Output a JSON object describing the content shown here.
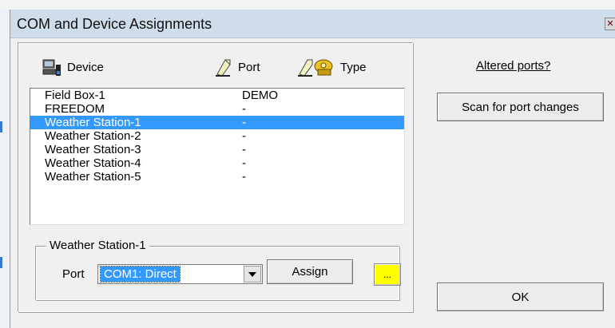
{
  "window": {
    "title": "COM and Device Assignments",
    "close_glyph": "✕"
  },
  "columns": {
    "device": "Device",
    "port": "Port",
    "type": "Type"
  },
  "devices": [
    {
      "name": "Field Box-1",
      "port": "DEMO",
      "selected": false
    },
    {
      "name": "FREEDOM",
      "port": "-",
      "selected": false
    },
    {
      "name": "Weather Station-1",
      "port": "-",
      "selected": true
    },
    {
      "name": "Weather Station-2",
      "port": "-",
      "selected": false
    },
    {
      "name": "Weather Station-3",
      "port": "-",
      "selected": false
    },
    {
      "name": "Weather Station-4",
      "port": "-",
      "selected": false
    },
    {
      "name": "Weather Station-5",
      "port": "-",
      "selected": false
    }
  ],
  "assignment": {
    "group_title": "Weather Station-1",
    "port_label": "Port",
    "port_value": "COM1: Direct",
    "assign_label": "Assign",
    "more_label": "..."
  },
  "side": {
    "altered_link": "Altered ports?",
    "scan_label": "Scan for port changes",
    "ok_label": "OK"
  },
  "colors": {
    "selection": "#3399ff",
    "highlight_button": "#ffff00"
  },
  "icons": {
    "device": "device-computer-icon",
    "port": "port-cable-icon",
    "type": "type-telephone-icon",
    "dropdown": "chevron-down-icon"
  }
}
